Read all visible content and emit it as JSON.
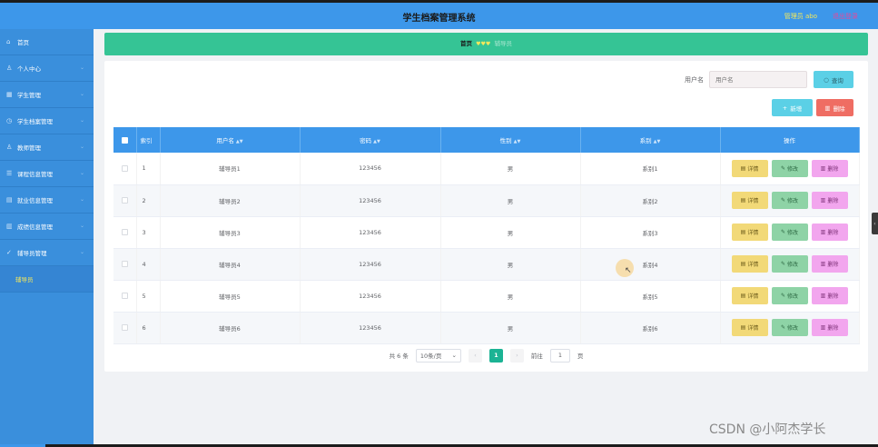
{
  "header": {
    "title": "学生档案管理系统",
    "user": "管理员 abo",
    "logout": "退出登录"
  },
  "sidebar": {
    "items": [
      {
        "icon": "⌂",
        "label": "首页",
        "has_arrow": false
      },
      {
        "icon": "♙",
        "label": "个人中心",
        "has_arrow": true
      },
      {
        "icon": "▦",
        "label": "学生管理",
        "has_arrow": true
      },
      {
        "icon": "◷",
        "label": "学生档案管理",
        "has_arrow": true
      },
      {
        "icon": "♙",
        "label": "教师管理",
        "has_arrow": true
      },
      {
        "icon": "☰",
        "label": "课程信息管理",
        "has_arrow": true
      },
      {
        "icon": "▤",
        "label": "就业信息管理",
        "has_arrow": true
      },
      {
        "icon": "▥",
        "label": "成绩信息管理",
        "has_arrow": true
      },
      {
        "icon": "✓",
        "label": "辅导员管理",
        "has_arrow": true
      }
    ],
    "submenu": "辅导员"
  },
  "breadcrumb": {
    "home": "首页",
    "separator": "♥♥♥",
    "current": "辅导员"
  },
  "search": {
    "label": "用户名",
    "placeholder": "用户名",
    "query_label": "查询",
    "add_label": "新增",
    "delete_label": "删除"
  },
  "table": {
    "headers": {
      "index": "索引",
      "username": "用户名",
      "password": "密码",
      "gender": "性别",
      "department": "系别",
      "actions": "操作"
    },
    "rows": [
      {
        "index": "1",
        "username": "辅导员1",
        "password": "123456",
        "gender": "男",
        "department": "系别1"
      },
      {
        "index": "2",
        "username": "辅导员2",
        "password": "123456",
        "gender": "男",
        "department": "系别2"
      },
      {
        "index": "3",
        "username": "辅导员3",
        "password": "123456",
        "gender": "男",
        "department": "系别3"
      },
      {
        "index": "4",
        "username": "辅导员4",
        "password": "123456",
        "gender": "男",
        "department": "系别4"
      },
      {
        "index": "5",
        "username": "辅导员5",
        "password": "123456",
        "gender": "男",
        "department": "系别5"
      },
      {
        "index": "6",
        "username": "辅导员6",
        "password": "123456",
        "gender": "男",
        "department": "系别6"
      }
    ],
    "actions": {
      "detail": "详情",
      "edit": "修改",
      "delete": "删除"
    }
  },
  "pager": {
    "total": "共 6 条",
    "page_size": "10条/页",
    "current_page": "1",
    "goto_label": "前往",
    "goto_value": "1",
    "page_unit": "页"
  },
  "watermark": "CSDN @小阿杰学长",
  "colors": {
    "header": "#3d97ea",
    "sidebar": "#3a8fdc",
    "breadcrumb": "#35c495",
    "page_active": "#1bb394"
  }
}
